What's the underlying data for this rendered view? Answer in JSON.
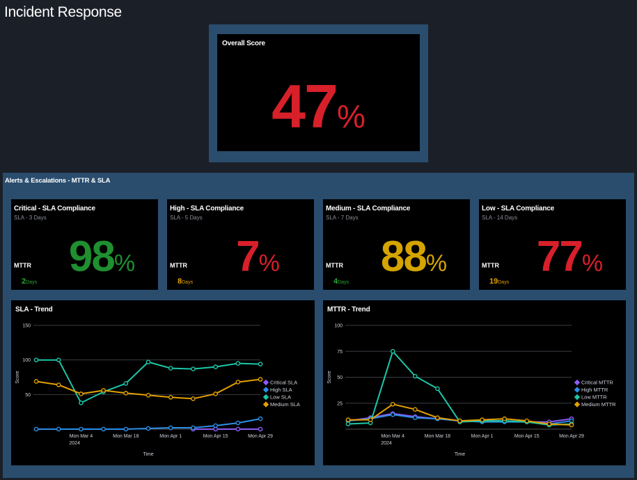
{
  "page": {
    "title": "Incident Response"
  },
  "overall": {
    "title": "Overall Score",
    "value": "47",
    "unit": "%",
    "color": "#d8202a"
  },
  "section": {
    "title": "Alerts & Escalations - MTTR & SLA"
  },
  "sla_cards": [
    {
      "title": "Critical - SLA Compliance",
      "subtitle": "SLA - 3 Days",
      "value": "98",
      "unit": "%",
      "value_color": "#1f8f2f",
      "mttr_label": "MTTR",
      "mttr_value": "2",
      "mttr_unit": "Days",
      "mttr_color": "#2aa834"
    },
    {
      "title": "High - SLA Compliance",
      "subtitle": "SLA - 5 Days",
      "value": "7",
      "unit": "%",
      "value_color": "#d8202a",
      "mttr_label": "MTTR",
      "mttr_value": "8",
      "mttr_unit": "Days",
      "mttr_color": "#e3a000"
    },
    {
      "title": "Medium - SLA Compliance",
      "subtitle": "SLA - 7 Days",
      "value": "88",
      "unit": "%",
      "value_color": "#d4a400",
      "mttr_label": "MTTR",
      "mttr_value": "4",
      "mttr_unit": "Days",
      "mttr_color": "#2aa834"
    },
    {
      "title": "Low - SLA Compliance",
      "subtitle": "SLA - 14 Days",
      "value": "77",
      "unit": "%",
      "value_color": "#d8202a",
      "mttr_label": "MTTR",
      "mttr_value": "19",
      "mttr_unit": "Days",
      "mttr_color": "#e3a000"
    }
  ],
  "chart_data": [
    {
      "type": "line",
      "title": "SLA - Trend",
      "xlabel": "Time",
      "ylabel": "Score",
      "ylim": [
        0,
        150
      ],
      "yticks": [
        50,
        100,
        150
      ],
      "x_tick_labels": [
        "Mon Mar 4",
        "Mon Mar 18",
        "Mon Apr 1",
        "Mon Apr 15",
        "Mon Apr 29"
      ],
      "x_tick_positions": [
        2,
        4,
        6,
        8,
        10
      ],
      "x_tick_sublabel": "2024",
      "x": [
        0,
        1,
        2,
        3,
        4,
        5,
        6,
        7,
        8,
        9,
        10
      ],
      "grid": true,
      "legend_position": "right",
      "series": [
        {
          "name": "Critical SLA",
          "color": "#8b5cf6",
          "values": [
            null,
            null,
            null,
            null,
            null,
            null,
            null,
            0,
            0,
            0,
            0
          ]
        },
        {
          "name": "High SLA",
          "color": "#2b8fe6",
          "values": [
            0,
            0,
            0,
            0,
            0,
            1,
            2,
            2,
            5,
            9,
            15
          ]
        },
        {
          "name": "Low SLA",
          "color": "#1cc7a8",
          "values": [
            100,
            100,
            38,
            54,
            66,
            97,
            88,
            87,
            90,
            95,
            94
          ]
        },
        {
          "name": "Medium SLA",
          "color": "#e3a000",
          "values": [
            69,
            64,
            51,
            56,
            52,
            49,
            46,
            44,
            51,
            68,
            72
          ]
        }
      ]
    },
    {
      "type": "line",
      "title": "MTTR - Trend",
      "xlabel": "Time",
      "ylabel": "Score",
      "ylim": [
        0,
        100
      ],
      "yticks": [
        25,
        50,
        75,
        100
      ],
      "x_tick_labels": [
        "Mon Mar 4",
        "Mon Mar 18",
        "Mon Apr 1",
        "Mon Apr 15",
        "Mon Apr 29"
      ],
      "x_tick_positions": [
        2,
        4,
        6,
        8,
        10
      ],
      "x_tick_sublabel": "2024",
      "x": [
        0,
        1,
        2,
        3,
        4,
        5,
        6,
        7,
        8,
        9,
        10
      ],
      "grid": true,
      "legend_position": "right",
      "series": [
        {
          "name": "Critical MTTR",
          "color": "#8b5cf6",
          "values": [
            8,
            11,
            15,
            12,
            10,
            8,
            8,
            8,
            7,
            7,
            10
          ]
        },
        {
          "name": "High MTTR",
          "color": "#2b8fe6",
          "values": [
            8,
            10,
            14,
            11,
            10,
            8,
            7,
            7,
            7,
            5,
            8
          ]
        },
        {
          "name": "Low MTTR",
          "color": "#1cc7a8",
          "values": [
            5,
            6,
            75,
            51,
            39,
            7,
            8,
            8,
            7,
            4,
            5
          ]
        },
        {
          "name": "Medium MTTR",
          "color": "#e3a000",
          "values": [
            9,
            9,
            24,
            19,
            11,
            8,
            9,
            10,
            8,
            5,
            4
          ]
        }
      ]
    }
  ]
}
